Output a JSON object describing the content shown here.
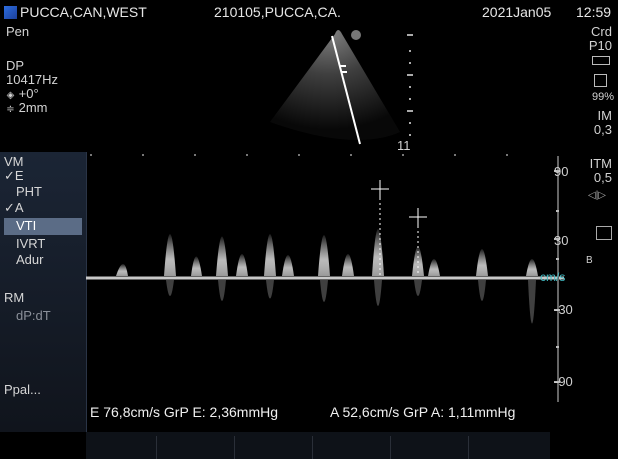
{
  "header": {
    "patient": "PUCCA,CAN,WEST",
    "id": "210105,PUCCA,CA.",
    "date": "2021Jan05",
    "time": "12:59"
  },
  "left_params": {
    "probe": "Pen",
    "mode": "DP",
    "frequency": "10417Hz",
    "angle": "+0°",
    "gate": "2mm"
  },
  "right_params": {
    "preset": "Crd",
    "probe_code": "P10",
    "storage": "99%",
    "im_label": "IM",
    "im_value": "0,3",
    "itm_label": "ITM",
    "itm_value": "0,5",
    "b_label": "B"
  },
  "sector": {
    "depth_label": "11"
  },
  "menu": {
    "vm": "VM",
    "e": "E",
    "pht": "PHT",
    "a": "A",
    "vti": "VTI",
    "ivrt": "IVRT",
    "adur": "Adur",
    "rm": "RM",
    "dpdt": "dP:dT",
    "ppal": "Ppal..."
  },
  "scale": {
    "top": "90",
    "mid": "30",
    "unit": "cm/s",
    "neg_mid": "-30",
    "bottom": "-90"
  },
  "measurements": {
    "e_text": "E 76,8cm/s GrP E: 2,36mmHg",
    "a_text": "A 52,6cm/s GrP A: 1,11mmHg"
  },
  "colors": {
    "accent": "#3fb8c0",
    "menu_selected": "#5b6c86",
    "background": "#000000"
  }
}
